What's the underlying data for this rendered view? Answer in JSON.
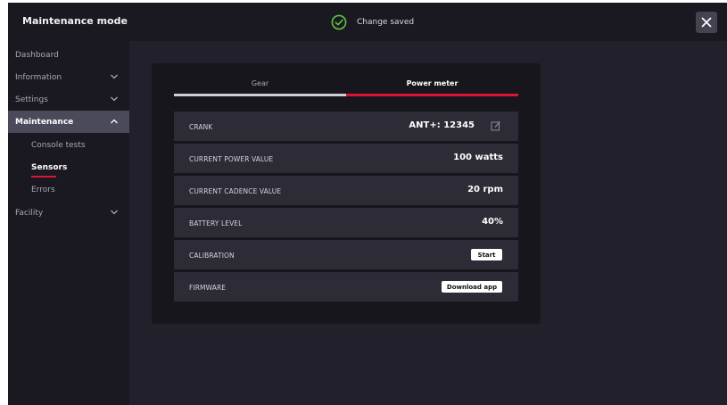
{
  "topbar": {
    "title": "Maintenance mode",
    "toast_text": "Change saved",
    "close_icon": "close-icon",
    "toast_icon": "check-circle-icon"
  },
  "sidebar": {
    "items": [
      {
        "label": "Dashboard",
        "expandable": false
      },
      {
        "label": "Information",
        "expandable": true,
        "chevron": "chevron-down-icon"
      },
      {
        "label": "Settings",
        "expandable": true,
        "chevron": "chevron-down-icon"
      },
      {
        "label": "Maintenance",
        "expandable": true,
        "chevron": "chevron-up-icon",
        "active": true
      },
      {
        "label": "Facility",
        "expandable": true,
        "chevron": "chevron-down-icon"
      }
    ],
    "sub_items": [
      {
        "label": "Console tests"
      },
      {
        "label": "Sensors",
        "active": true
      },
      {
        "label": "Errors"
      }
    ]
  },
  "tabs": [
    {
      "label": "Gear"
    },
    {
      "label": "Power meter",
      "active": true
    }
  ],
  "rows": [
    {
      "label": "CRANK",
      "value": "ANT+: 12345",
      "icon": "edit-icon"
    },
    {
      "label": "CURRENT POWER VALUE",
      "value": "100 watts"
    },
    {
      "label": "CURRENT CADENCE VALUE",
      "value": "20 rpm"
    },
    {
      "label": "BATTERY LEVEL",
      "value": "40%"
    },
    {
      "label": "CALIBRATION",
      "button": "Start"
    },
    {
      "label": "FIRMWARE",
      "button": "Download app"
    }
  ],
  "colors": {
    "accent": "#d9163a",
    "success": "#5fc43f",
    "background": "#22212b",
    "panel": "#17161d",
    "row": "#2c2b36"
  }
}
